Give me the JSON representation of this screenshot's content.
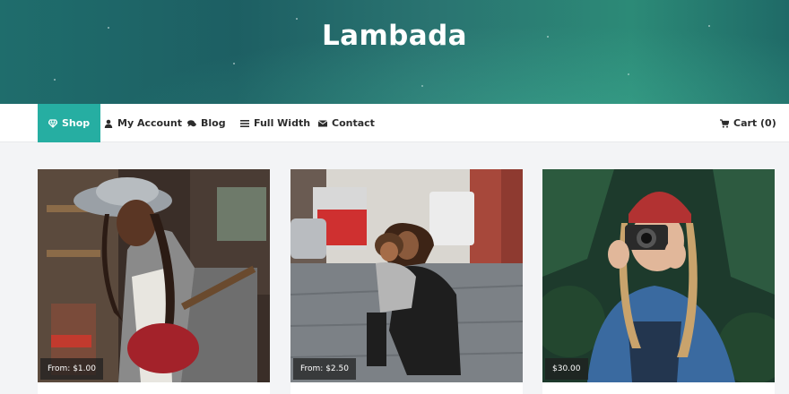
{
  "site": {
    "title": "Lambada"
  },
  "nav": {
    "items": [
      {
        "label": "Shop",
        "icon": "diamond-icon",
        "active": true
      },
      {
        "label": "My Account",
        "icon": "user-icon"
      },
      {
        "label": "Blog",
        "icon": "comments-icon"
      },
      {
        "label": "Full Width",
        "icon": "bars-icon"
      },
      {
        "label": "Contact",
        "icon": "envelope-icon"
      }
    ],
    "cart": {
      "label": "Cart (0)",
      "icon": "cart-icon"
    }
  },
  "products": [
    {
      "price": "From: $1.00",
      "image": "woman-playing-red-guitar-photo"
    },
    {
      "price": "From: $2.50",
      "image": "mother-and-child-on-street-photo"
    },
    {
      "price": "$30.00",
      "image": "woman-with-camera-in-red-beanie-photo"
    }
  ],
  "colors": {
    "accent": "#26aea2",
    "header": "#1f6d6c"
  }
}
